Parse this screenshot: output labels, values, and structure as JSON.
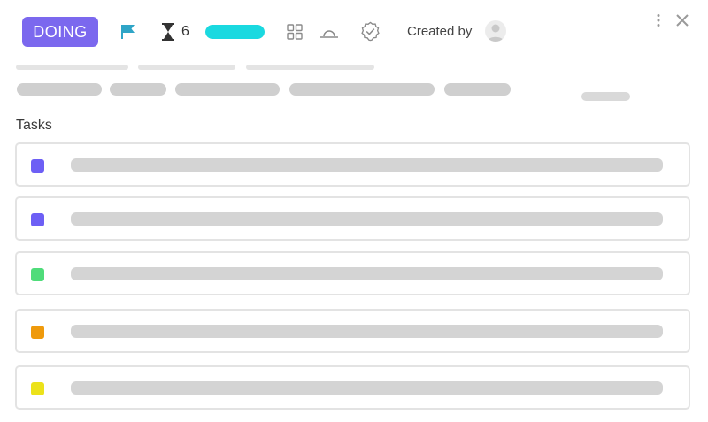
{
  "header": {
    "status_label": "DOING",
    "time_estimate": "6",
    "progress_percent": 100,
    "created_by_label": "Created by"
  },
  "colors": {
    "status": "#7b68ee",
    "flag": "#2fa5c7",
    "progress": "#1ad9e0"
  },
  "icons": [
    "flag-icon",
    "hourglass-icon",
    "grid-icon",
    "loop-icon",
    "check-circle-icon",
    "avatar-icon",
    "kebab-menu-icon",
    "close-icon"
  ],
  "tasks": {
    "title": "Tasks",
    "items": [
      {
        "color": "#6d5ff5"
      },
      {
        "color": "#6d5ff5"
      },
      {
        "color": "#4fdc7a"
      },
      {
        "color": "#ef9a0c"
      },
      {
        "color": "#ece21a"
      }
    ]
  }
}
